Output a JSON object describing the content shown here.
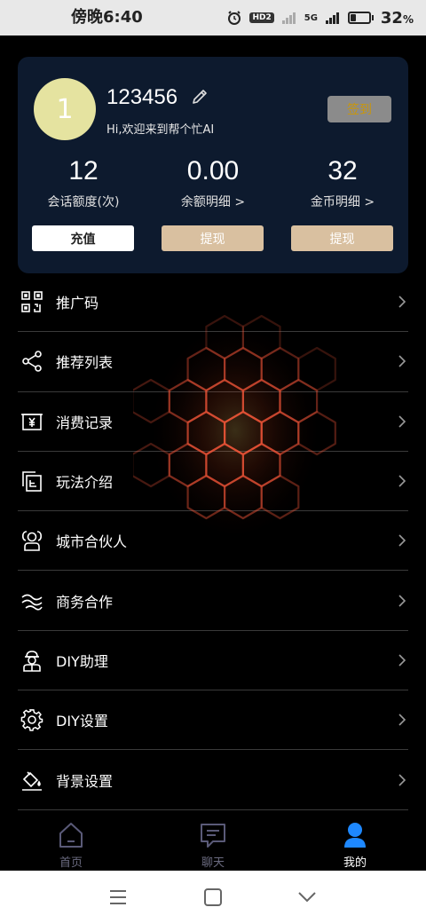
{
  "status_bar": {
    "time": "傍晚6:40",
    "hd_badge": "HD2",
    "network": "5G",
    "battery_percent": "32",
    "battery_unit": "%",
    "battery_level": 0.32
  },
  "profile": {
    "avatar_initial": "1",
    "username": "123456",
    "welcome": "Hi,欢迎来到帮个忙AI",
    "signin_label": "签到"
  },
  "stats": [
    {
      "value": "12",
      "label": "会话额度(次)",
      "button": "充值"
    },
    {
      "value": "0.00",
      "label": "余额明细 >",
      "button": "提现"
    },
    {
      "value": "32",
      "label": "金币明细 >",
      "button": "提现"
    }
  ],
  "menu": [
    {
      "label": "推广码",
      "icon": "qr-code-icon"
    },
    {
      "label": "推荐列表",
      "icon": "share-icon"
    },
    {
      "label": "消费记录",
      "icon": "yen-receipt-icon"
    },
    {
      "label": "玩法介绍",
      "icon": "document-icon"
    },
    {
      "label": "城市合伙人",
      "icon": "people-icon"
    },
    {
      "label": "商务合作",
      "icon": "waves-icon"
    },
    {
      "label": "DIY助理",
      "icon": "assistant-icon"
    },
    {
      "label": "DIY设置",
      "icon": "gear-icon"
    },
    {
      "label": "背景设置",
      "icon": "paint-bucket-icon"
    }
  ],
  "tabs": [
    {
      "label": "首页",
      "icon": "home-icon",
      "active": false
    },
    {
      "label": "聊天",
      "icon": "chat-icon",
      "active": false
    },
    {
      "label": "我的",
      "icon": "user-icon",
      "active": true
    }
  ],
  "colors": {
    "card_bg": "#0d1a2e",
    "avatar_bg": "#e5e3a0",
    "withdraw_bg": "#d9c0a0",
    "signin_bg": "#8b8b8b",
    "signin_text": "#c8960c",
    "active_tab": "#1e88ff"
  }
}
